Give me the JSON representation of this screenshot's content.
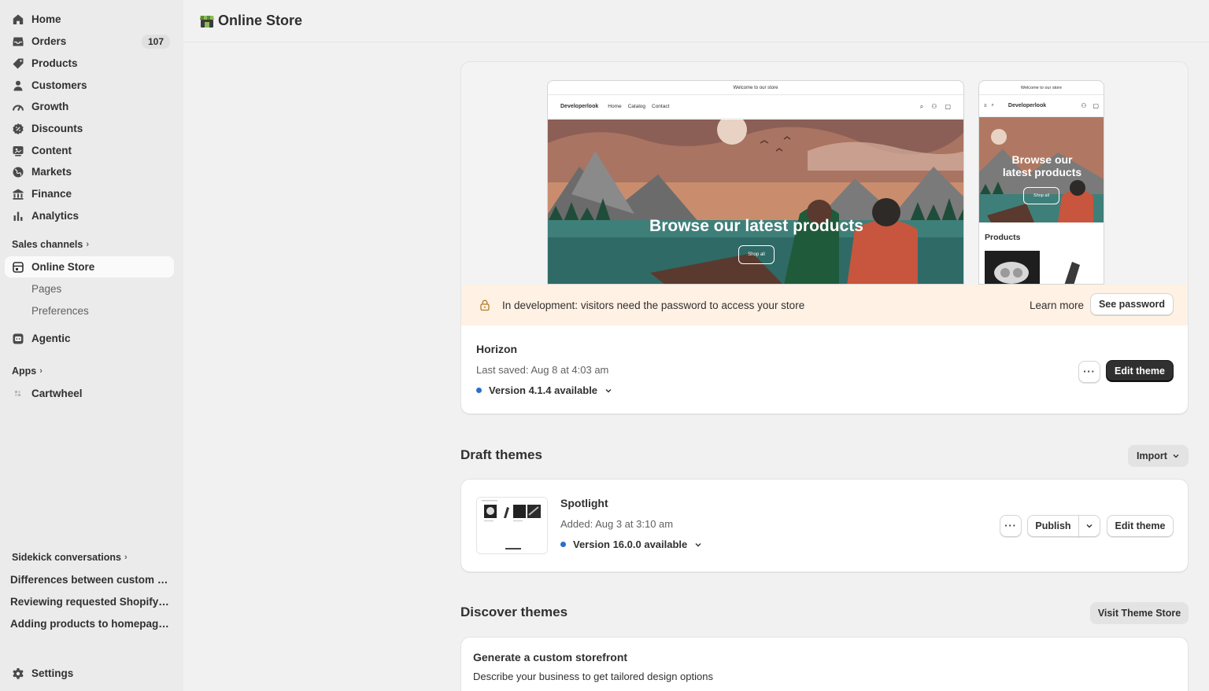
{
  "sidebar": {
    "nav": [
      {
        "label": "Home",
        "icon": "home-icon"
      },
      {
        "label": "Orders",
        "icon": "inbox-icon",
        "badge": "107"
      },
      {
        "label": "Products",
        "icon": "tag-icon"
      },
      {
        "label": "Customers",
        "icon": "person-icon"
      },
      {
        "label": "Growth",
        "icon": "gauge-icon"
      },
      {
        "label": "Discounts",
        "icon": "discount-icon"
      },
      {
        "label": "Content",
        "icon": "content-icon"
      },
      {
        "label": "Markets",
        "icon": "globe-icon"
      },
      {
        "label": "Finance",
        "icon": "bank-icon"
      },
      {
        "label": "Analytics",
        "icon": "chart-icon"
      }
    ],
    "sales_channels_label": "Sales channels",
    "online_store_label": "Online Store",
    "sub_items": [
      "Pages",
      "Preferences"
    ],
    "agentic_label": "Agentic",
    "apps_label": "Apps",
    "cartwheel_label": "Cartwheel",
    "sidekick_label": "Sidekick conversations",
    "conversations": [
      "Differences between custom a...",
      "Reviewing requested Shopify p...",
      "Adding products to homepage ..."
    ],
    "settings_label": "Settings"
  },
  "header": {
    "title": "Online Store"
  },
  "preview": {
    "announcement": "Welcome to our store",
    "brand": "Developerlook",
    "nav_links": [
      "Home",
      "Catalog",
      "Contact"
    ],
    "hero_title": "Browse our latest products",
    "hero_button": "Shop all",
    "phone_hero_line1": "Browse our",
    "phone_hero_line2": "latest products",
    "phone_products_heading": "Products"
  },
  "dev_banner": {
    "message": "In development: visitors need the password to access your store",
    "learn_more": "Learn more",
    "see_password": "See password"
  },
  "current_theme": {
    "name": "Horizon",
    "last_saved": "Last saved: Aug 8 at 4:03 am",
    "version": "Version 4.1.4 available",
    "more_label": "···",
    "edit_label": "Edit theme"
  },
  "draft_section": {
    "title": "Draft themes",
    "import_label": "Import"
  },
  "draft_theme": {
    "name": "Spotlight",
    "added": "Added: Aug 3 at 3:10 am",
    "version": "Version 16.0.0 available",
    "more_label": "···",
    "publish_label": "Publish",
    "edit_label": "Edit theme"
  },
  "discover_section": {
    "title": "Discover themes",
    "visit_label": "Visit Theme Store"
  },
  "custom_storefront": {
    "title": "Generate a custom storefront",
    "description": "Describe your business to get tailored design options"
  },
  "colors": {
    "primary_button": "#303030",
    "banner_bg": "#fff1e3",
    "version_dot": "#2c6ecb",
    "sidebar_bg": "#ebebeb"
  }
}
